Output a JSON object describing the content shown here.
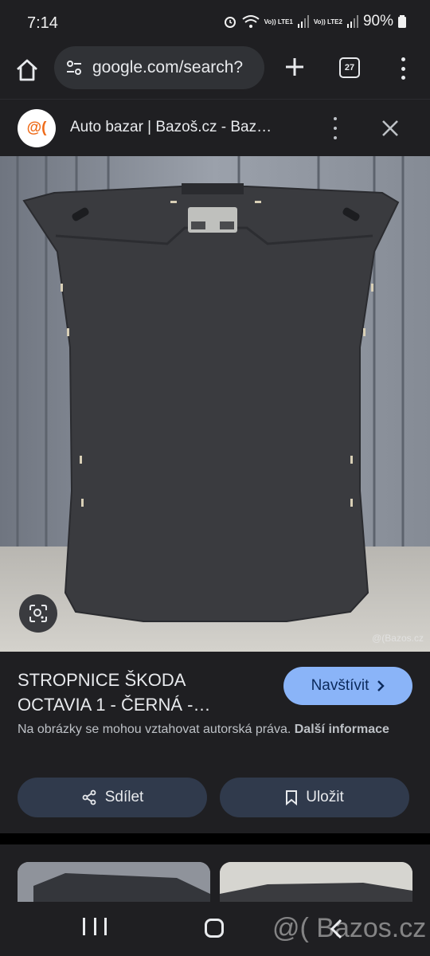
{
  "status_bar": {
    "time": "7:14",
    "battery": "90%",
    "lte1": "Vo)) LTE1",
    "lte2": "Vo)) LTE2"
  },
  "browser": {
    "url": "google.com/search?",
    "tab_count": "27"
  },
  "result_header": {
    "site_logo": "@(",
    "title": "Auto bazar | Bazoš.cz - Baz…"
  },
  "image": {
    "watermark": "@(Bazos.cz",
    "lens_icon": "lens-icon"
  },
  "info": {
    "title": "STROPNICE ŠKODA OCTAVIA 1 - ČERNÁ -…",
    "visit_label": "Navštívit",
    "copyright_text": "Na obrázky se mohou vztahovat autorská práva.",
    "copyright_link": "Další informace",
    "share_label": "Sdílet",
    "save_label": "Uložit"
  },
  "nav": {
    "watermark": "@( Bazos.cz"
  },
  "colors": {
    "accent": "#8ab4f8",
    "panel": "#1f1f22",
    "button": "#303a4c"
  }
}
